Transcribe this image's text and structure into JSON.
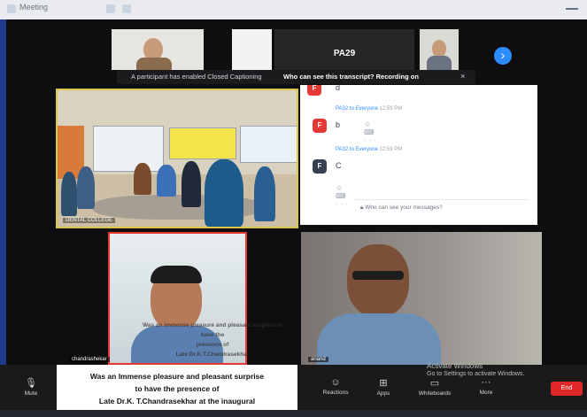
{
  "topbar": {
    "title": "Meeting"
  },
  "thumbnails": [
    {
      "name": ""
    },
    {
      "name": "PA29"
    }
  ],
  "caption_banner": {
    "notice": "A participant has enabled Closed Captioning",
    "link": "Who can see this transcript? Recording on",
    "close": "×"
  },
  "room_video": {
    "label": "DENTAL COLLEGE"
  },
  "chat": {
    "messages": [
      {
        "avatar": "F",
        "avatar_color": "#e53935",
        "text": "d"
      },
      {
        "avatar": "F",
        "avatar_color": "#e53935",
        "sender": "PA32 to Everyone",
        "time": "12:59 PM",
        "text": "b"
      },
      {
        "avatar": "F",
        "avatar_color": "#374151",
        "sender": "PA32 to Everyone",
        "time": "12:59 PM",
        "text": "C"
      }
    ],
    "input_placeholder": "Who can see your messages?"
  },
  "videos": [
    {
      "name": "chandrashekar"
    },
    {
      "name": "anand"
    }
  ],
  "overlay_caption": [
    "Was an immense pleasure and pleasant surprise to have the",
    "presence of",
    "Late Dr.K.T.Chandrasekhar"
  ],
  "caption_box": [
    "Was an Immense pleasure and pleasant surprise",
    "to have the presence of",
    "Late Dr.K. T.Chandrasekhar at the inaugural"
  ],
  "activate": [
    "Activate Windows",
    "Go to Settings to activate Windows."
  ],
  "toolbar": {
    "items": [
      {
        "icon": "microphone-icon",
        "label": "Mute"
      },
      {
        "icon": "reactions-icon",
        "label": "Reactions"
      },
      {
        "icon": "apps-icon",
        "label": "Apps"
      },
      {
        "icon": "whiteboard-icon",
        "label": "Whiteboards"
      },
      {
        "icon": "more-icon",
        "label": "More"
      }
    ],
    "end_label": "End"
  }
}
